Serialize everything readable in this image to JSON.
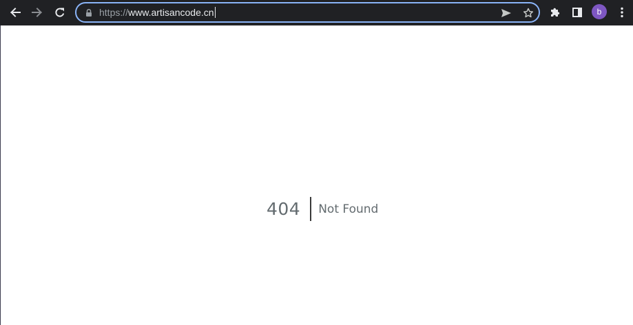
{
  "browser": {
    "url_scheme": "https://",
    "url_host": "www.artisancode.cn",
    "profile_initial": "b",
    "profile_color": "#7e57c2",
    "accent_color": "#8ab4f8",
    "icons": {
      "back": "arrow-left",
      "forward": "arrow-right",
      "reload": "reload",
      "lock": "lock",
      "send": "send-arrow",
      "bookmark": "star-outline",
      "extensions": "puzzle",
      "side_panel": "side-panel",
      "menu": "kebab-vertical"
    }
  },
  "page": {
    "status_code": "404",
    "status_message": "Not Found",
    "text_color": "#636b6f"
  }
}
